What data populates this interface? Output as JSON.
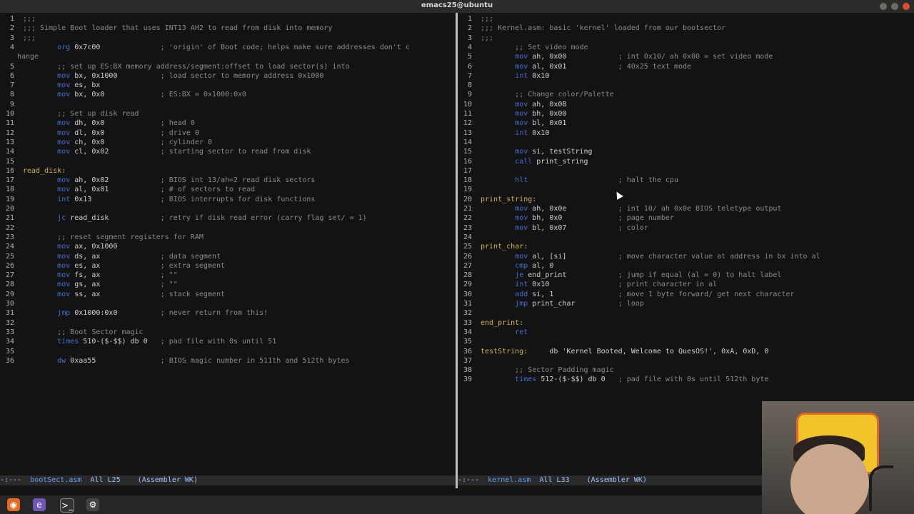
{
  "window": {
    "title": "emacs25@ubuntu"
  },
  "colors": {
    "keyword": "#3f6fd8",
    "comment": "#8a8a8a",
    "label": "#d0b34a",
    "background": "#131313"
  },
  "left_buffer": {
    "filename": "bootSect.asm",
    "lines": [
      {
        "n": "1",
        "t": ";;;",
        "k": "cm"
      },
      {
        "n": "2",
        "t": ";;; Simple Boot loader that uses INT13 AH2 to read from disk into memory",
        "k": "cm"
      },
      {
        "n": "3",
        "t": ";;;",
        "k": "cm"
      },
      {
        "n": "4",
        "t": "        org 0x7c00              ; 'origin' of Boot code; helps make sure addresses don't c",
        "k": "kw"
      },
      {
        "n": "",
        "t": "hange",
        "k": "cm"
      },
      {
        "n": "5",
        "t": "        ;; set up ES:BX memory address/segment:offset to load sector(s) into",
        "k": "cm"
      },
      {
        "n": "6",
        "t": "        mov bx, 0x1000          ; load sector to memory address 0x1000",
        "k": "kw"
      },
      {
        "n": "7",
        "t": "        mov es, bx",
        "k": "kw"
      },
      {
        "n": "8",
        "t": "        mov bx, 0x0             ; ES:BX = 0x1000:0x0",
        "k": "kw"
      },
      {
        "n": "9",
        "t": "",
        "k": ""
      },
      {
        "n": "10",
        "t": "        ;; Set up disk read",
        "k": "cm"
      },
      {
        "n": "11",
        "t": "        mov dh, 0x0             ; head 0",
        "k": "kw"
      },
      {
        "n": "12",
        "t": "        mov dl, 0x0             ; drive 0",
        "k": "kw"
      },
      {
        "n": "13",
        "t": "        mov ch, 0x0             ; cylinder 0",
        "k": "kw"
      },
      {
        "n": "14",
        "t": "        mov cl, 0x02            ; starting sector to read from disk",
        "k": "kw"
      },
      {
        "n": "15",
        "t": "",
        "k": ""
      },
      {
        "n": "16",
        "t": "read_disk:",
        "k": "lbl"
      },
      {
        "n": "17",
        "t": "        mov ah, 0x02            ; BIOS int 13/ah=2 read disk sectors",
        "k": "kw"
      },
      {
        "n": "18",
        "t": "        mov al, 0x01            ; # of sectors to read",
        "k": "kw"
      },
      {
        "n": "19",
        "t": "        int 0x13                ; BIOS interrupts for disk functions",
        "k": "kw"
      },
      {
        "n": "20",
        "t": "",
        "k": ""
      },
      {
        "n": "21",
        "t": "        jc read_disk            ; retry if disk read error (carry flag set/ = 1)",
        "k": "kw"
      },
      {
        "n": "22",
        "t": "",
        "k": ""
      },
      {
        "n": "23",
        "t": "        ;; reset segment registers for RAM",
        "k": "cm"
      },
      {
        "n": "24",
        "t": "        mov ax, 0x1000",
        "k": "kw"
      },
      {
        "n": "25",
        "t": "        mov ds, ax              ; data segment",
        "k": "kw"
      },
      {
        "n": "26",
        "t": "        mov es, ax              ; extra segment",
        "k": "kw"
      },
      {
        "n": "27",
        "t": "        mov fs, ax              ; \"\"",
        "k": "kw"
      },
      {
        "n": "28",
        "t": "        mov gs, ax              ; \"\"",
        "k": "kw"
      },
      {
        "n": "29",
        "t": "        mov ss, ax              ; stack segment",
        "k": "kw"
      },
      {
        "n": "30",
        "t": "",
        "k": ""
      },
      {
        "n": "31",
        "t": "        jmp 0x1000:0x0          ; never return from this!",
        "k": "kw"
      },
      {
        "n": "32",
        "t": "",
        "k": ""
      },
      {
        "n": "33",
        "t": "        ;; Boot Sector magic",
        "k": "cm"
      },
      {
        "n": "34",
        "t": "        times 510-($-$$) db 0   ; pad file with 0s until 51",
        "k": "kw"
      },
      {
        "n": "35",
        "t": "",
        "k": ""
      },
      {
        "n": "36",
        "t": "        dw 0xaa55               ; BIOS magic number in 511th and 512th bytes",
        "k": "kw"
      }
    ],
    "modeline": {
      "prefix": "-:---  ",
      "position": "  All L25",
      "mode": "    (Assembler WK)"
    }
  },
  "right_buffer": {
    "filename": "kernel.asm",
    "lines": [
      {
        "n": "1",
        "t": ";;;",
        "k": "cm"
      },
      {
        "n": "2",
        "t": ";;; Kernel.asm: basic 'kernel' loaded from our bootsector",
        "k": "cm"
      },
      {
        "n": "3",
        "t": ";;;",
        "k": "cm"
      },
      {
        "n": "4",
        "t": "        ;; Set video mode",
        "k": "cm"
      },
      {
        "n": "5",
        "t": "        mov ah, 0x00            ; int 0x10/ ah 0x00 = set video mode",
        "k": "kw"
      },
      {
        "n": "6",
        "t": "        mov al, 0x01            ; 40x25 text mode",
        "k": "kw"
      },
      {
        "n": "7",
        "t": "        int 0x10",
        "k": "kw"
      },
      {
        "n": "8",
        "t": "",
        "k": ""
      },
      {
        "n": "9",
        "t": "        ;; Change color/Palette",
        "k": "cm"
      },
      {
        "n": "10",
        "t": "        mov ah, 0x0B",
        "k": "kw"
      },
      {
        "n": "11",
        "t": "        mov bh, 0x00",
        "k": "kw"
      },
      {
        "n": "12",
        "t": "        mov bl, 0x01",
        "k": "kw"
      },
      {
        "n": "13",
        "t": "        int 0x10",
        "k": "kw"
      },
      {
        "n": "14",
        "t": "",
        "k": ""
      },
      {
        "n": "15",
        "t": "        mov si, testString",
        "k": "kw"
      },
      {
        "n": "16",
        "t": "        call print_string",
        "k": "kw"
      },
      {
        "n": "17",
        "t": "",
        "k": ""
      },
      {
        "n": "18",
        "t": "        hlt                     ; halt the cpu",
        "k": "kw"
      },
      {
        "n": "19",
        "t": "",
        "k": ""
      },
      {
        "n": "20",
        "t": "print_string:",
        "k": "lbl"
      },
      {
        "n": "21",
        "t": "        mov ah, 0x0e            ; int 10/ ah 0x0e BIOS teletype output",
        "k": "kw"
      },
      {
        "n": "22",
        "t": "        mov bh, 0x0             ; page number",
        "k": "kw"
      },
      {
        "n": "23",
        "t": "        mov bl, 0x07            ; color",
        "k": "kw"
      },
      {
        "n": "24",
        "t": "",
        "k": ""
      },
      {
        "n": "25",
        "t": "print_char:",
        "k": "lbl"
      },
      {
        "n": "26",
        "t": "        mov al, [si]            ; move character value at address in bx into al",
        "k": "kw"
      },
      {
        "n": "27",
        "t": "        cmp al, 0",
        "k": "kw"
      },
      {
        "n": "28",
        "t": "        je end_print            ; jump if equal (al = 0) to halt label",
        "k": "kw"
      },
      {
        "n": "29",
        "t": "        int 0x10                ; print character in al",
        "k": "kw"
      },
      {
        "n": "30",
        "t": "        add si, 1               ; move 1 byte forward/ get next character",
        "k": "kw"
      },
      {
        "n": "31",
        "t": "        jmp print_char          ; loop",
        "k": "kw"
      },
      {
        "n": "32",
        "t": "",
        "k": ""
      },
      {
        "n": "33",
        "t": "end_print:",
        "k": "lbl"
      },
      {
        "n": "34",
        "t": "        ret",
        "k": "kw"
      },
      {
        "n": "35",
        "t": "",
        "k": ""
      },
      {
        "n": "36",
        "t": "testString:     db 'Kernel Booted, Welcome to QuesOS!', 0xA, 0xD, 0",
        "k": "lbl"
      },
      {
        "n": "37",
        "t": "",
        "k": ""
      },
      {
        "n": "38",
        "t": "        ;; Sector Padding magic",
        "k": "cm"
      },
      {
        "n": "39",
        "t": "        times 512-($-$$) db 0   ; pad file with 0s until 512th byte",
        "k": "kw"
      }
    ],
    "modeline": {
      "prefix": "-:---  ",
      "position": "  All L33",
      "mode": "    (Assembler WK)"
    }
  },
  "taskbar": {
    "icons": [
      "firefox-icon",
      "emacs-icon",
      "terminal-icon",
      "settings-icon"
    ]
  }
}
